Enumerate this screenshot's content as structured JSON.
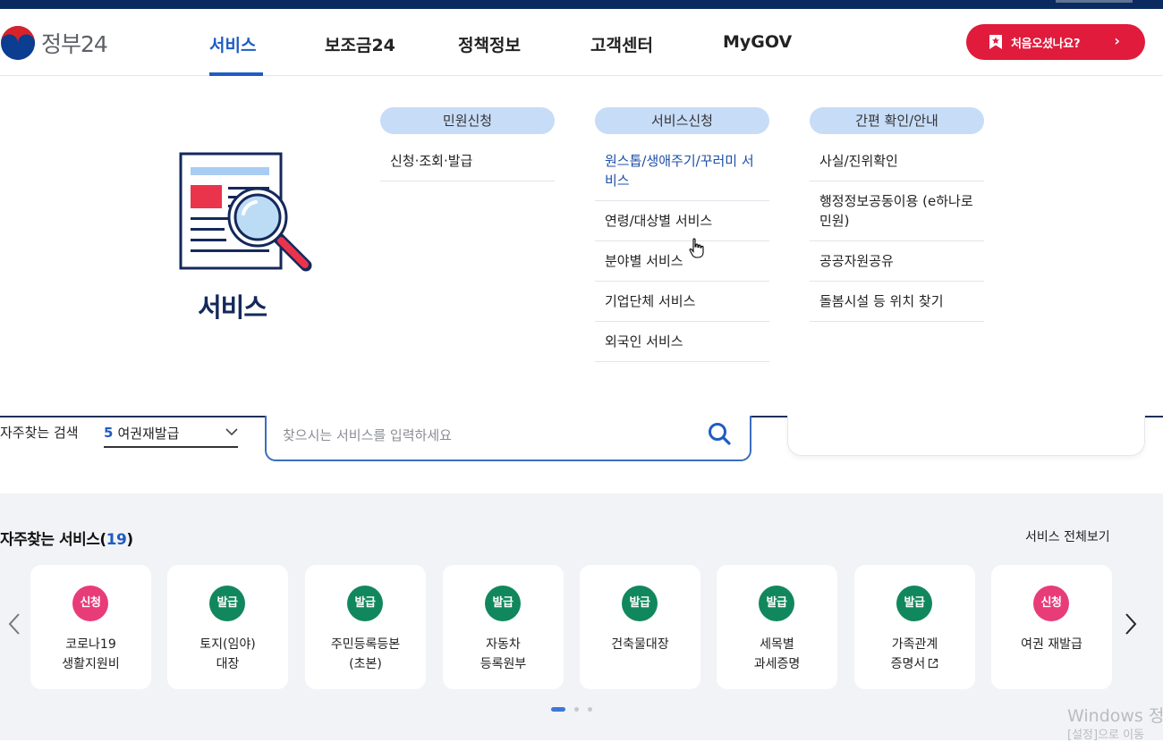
{
  "header": {
    "logo_text": "정부24",
    "nav": [
      {
        "label": "서비스",
        "active": true
      },
      {
        "label": "보조금24",
        "active": false
      },
      {
        "label": "정책정보",
        "active": false
      },
      {
        "label": "고객센터",
        "active": false
      },
      {
        "label": "MyGOV",
        "active": false
      }
    ],
    "first_visit_button": "처음오셨나요?"
  },
  "mega_menu": {
    "title": "서비스",
    "columns": [
      {
        "heading": "민원신청",
        "items": [
          "신청·조회·발급"
        ]
      },
      {
        "heading": "서비스신청",
        "items": [
          "원스톱/생애주기/꾸러미 서비스",
          "연령/대상별 서비스",
          "분야별 서비스",
          "기업단체 서비스",
          "외국인 서비스"
        ]
      },
      {
        "heading": "간편 확인/안내",
        "items": [
          "사실/진위확인",
          "행정정보공동이용 (e하나로민원)",
          "공공자원공유",
          "돌봄시설 등 위치 찾기"
        ]
      }
    ],
    "hovered_item": "원스톱/생애주기/꾸러미 서비스"
  },
  "search": {
    "frequent_label": "자주찾는 검색",
    "frequent_rank": "5",
    "frequent_value": "여권재발급",
    "placeholder": "찾으시는 서비스를 입력하세요"
  },
  "services": {
    "title": "자주찾는 서비스(",
    "count": "19",
    "title_close": ")",
    "view_all": "서비스 전체보기",
    "cards": [
      {
        "badge": "신청",
        "badge_color": "#e83c79",
        "label": "코로나19\n생활지원비",
        "external": false
      },
      {
        "badge": "발급",
        "badge_color": "#11875d",
        "label": "토지(임야)\n대장",
        "external": false
      },
      {
        "badge": "발급",
        "badge_color": "#11875d",
        "label": "주민등록등본\n(초본)",
        "external": false
      },
      {
        "badge": "발급",
        "badge_color": "#11875d",
        "label": "자동차\n등록원부",
        "external": false
      },
      {
        "badge": "발급",
        "badge_color": "#11875d",
        "label": "건축물대장",
        "external": false
      },
      {
        "badge": "발급",
        "badge_color": "#11875d",
        "label": "세목별\n과세증명",
        "external": false
      },
      {
        "badge": "발급",
        "badge_color": "#11875d",
        "label": "가족관계\n증명서",
        "external": true
      },
      {
        "badge": "신청",
        "badge_color": "#e83c79",
        "label": "여권 재발급",
        "external": false
      }
    ],
    "pagination": {
      "pages": 3,
      "current": 1
    }
  },
  "os_watermark": {
    "line1": "Windows 정",
    "line2": "[설정]으로 이동"
  },
  "colors": {
    "brand_blue": "#1e5cc4",
    "accent_red": "#e01b3c",
    "navy": "#0b2a5f",
    "issue_green": "#11875d",
    "apply_pink": "#e83c79"
  }
}
